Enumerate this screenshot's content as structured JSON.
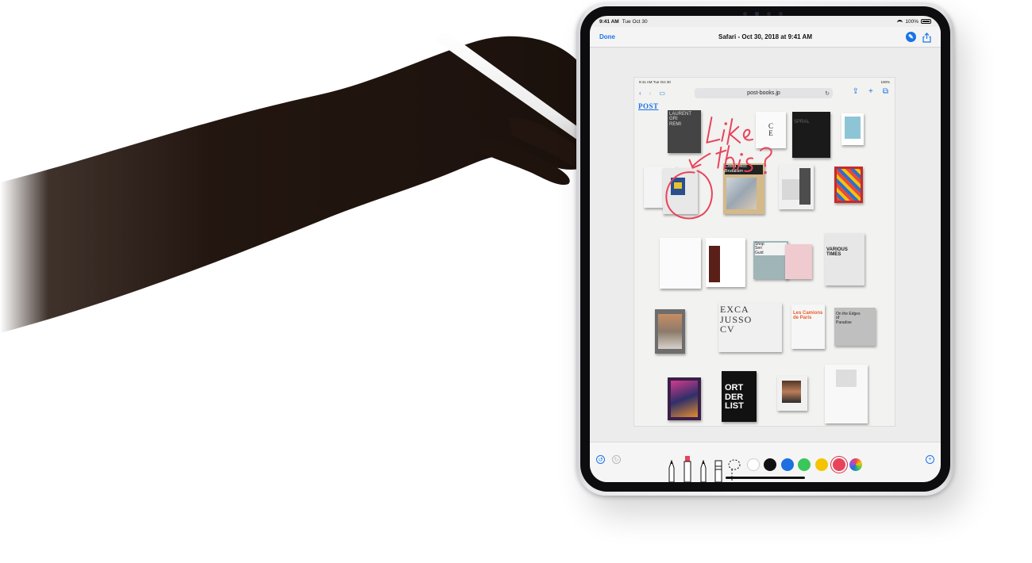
{
  "status_bar": {
    "time": "9:41 AM",
    "date": "Tue Oct 30",
    "battery": "100%"
  },
  "nav": {
    "done_label": "Done",
    "title": "Safari - Oct 30, 2018 at 9:41 AM",
    "markup_icon": "markup-pen-icon",
    "share_icon": "share-icon"
  },
  "page": {
    "status_time": "9:41 AM",
    "status_date": "Tue Oct 30",
    "status_battery": "100%",
    "url": "post-books.jp",
    "site_logo": "POST"
  },
  "annotation": {
    "text": "Like this?",
    "color": "#e8435a"
  },
  "toolbar": {
    "undo_icon": "undo-icon",
    "redo_icon": "redo-icon",
    "add_icon": "add-icon",
    "tools": [
      "pen",
      "marker",
      "pencil",
      "eraser",
      "lasso"
    ],
    "colors": [
      "#ffffff",
      "#111111",
      "#1e6fe0",
      "#39c65a",
      "#f5c400",
      "#e8435a",
      "multicolor"
    ],
    "selected_color": "#e8435a"
  },
  "books": [
    {
      "label": "LAURENT\nGRI\nREMI",
      "bg": "#444",
      "fg": "#ddd"
    },
    {
      "label": "C\nE",
      "bg": "#fafafa",
      "fg": "#222"
    },
    {
      "label": "SPRAL",
      "bg": "#1a1a1a",
      "fg": "#666"
    },
    {
      "label": "",
      "bg": "#fff",
      "fg": "#111"
    },
    {
      "label": "Costa Vecc\nBrutalism",
      "bg": "#d4b98a",
      "fg": "#222"
    },
    {
      "label": "Shop\nSeri\nGuid",
      "bg": "#9fb5b8",
      "fg": "#222"
    },
    {
      "label": "VARIOUS\nTIMES",
      "bg": "#e7e7e7",
      "fg": "#222"
    },
    {
      "label": "EXCA\nJUSSO\nCV",
      "bg": "#f0f0f0",
      "fg": "#333"
    },
    {
      "label": "Les Camions\nde Paris",
      "bg": "#f6f6f6",
      "fg": "#e85b2a"
    },
    {
      "label": "On the Edges\nof\nParadise",
      "bg": "#bfbfbf",
      "fg": "#222"
    },
    {
      "label": "ORT\nDER\nLIST",
      "bg": "#111",
      "fg": "#fff"
    }
  ]
}
